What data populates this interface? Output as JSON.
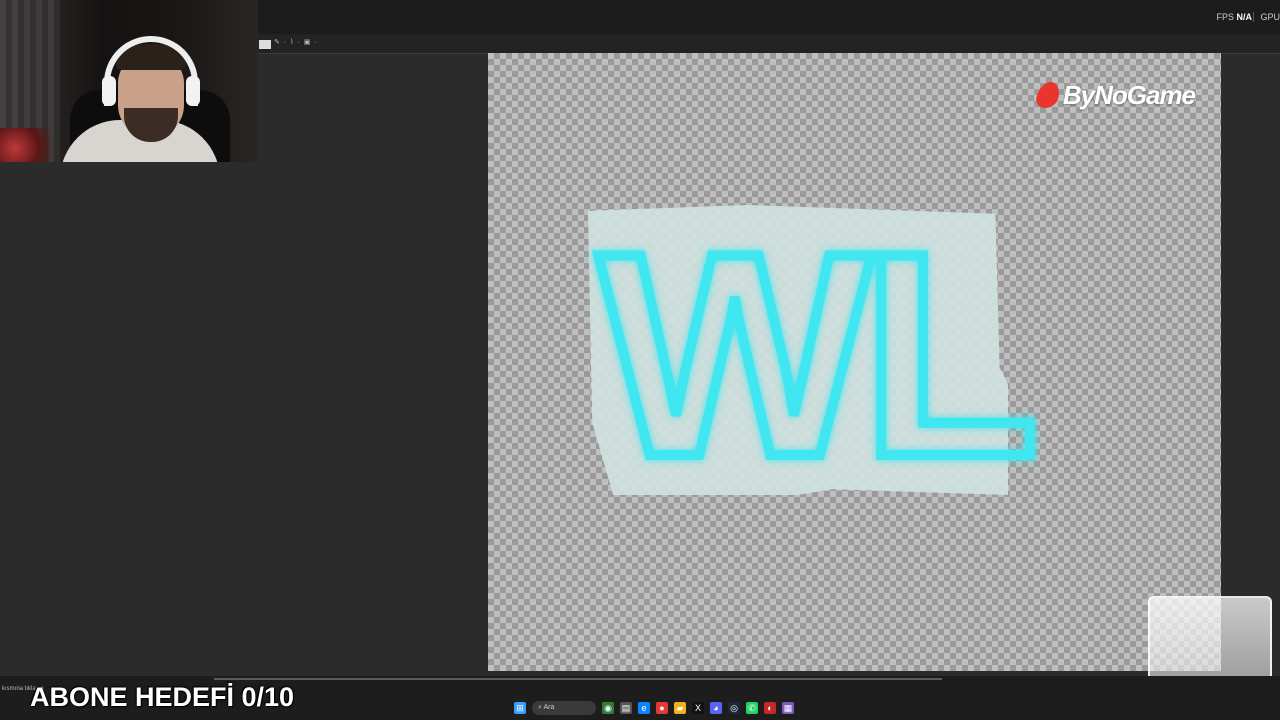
{
  "app": {
    "fps_label": "FPS",
    "fps_value": "N/A",
    "gpu_label": "GPU"
  },
  "toolbar": {
    "tools_text": "✎ · ⌇ · ▣ ·"
  },
  "canvas": {
    "brand_text": "ByNoGame",
    "artwork_text": "WL",
    "neon_color": "#3fe6f0"
  },
  "overlay": {
    "subscriber_goal": "ABONE HEDEFİ 0/10",
    "status_text": "kısmına tıklayın"
  },
  "taskbar": {
    "search_placeholder": "Ara",
    "icons": [
      "windows-icon",
      "search-icon",
      "widgets-icon",
      "files-icon",
      "edge-icon",
      "chrome-icon",
      "folder-icon",
      "x-icon",
      "discord-icon",
      "steam-icon",
      "whatsapp-icon",
      "other-icon",
      "notes-icon"
    ]
  },
  "tray": {
    "dots": [
      "✓",
      "✓",
      "✓"
    ]
  }
}
